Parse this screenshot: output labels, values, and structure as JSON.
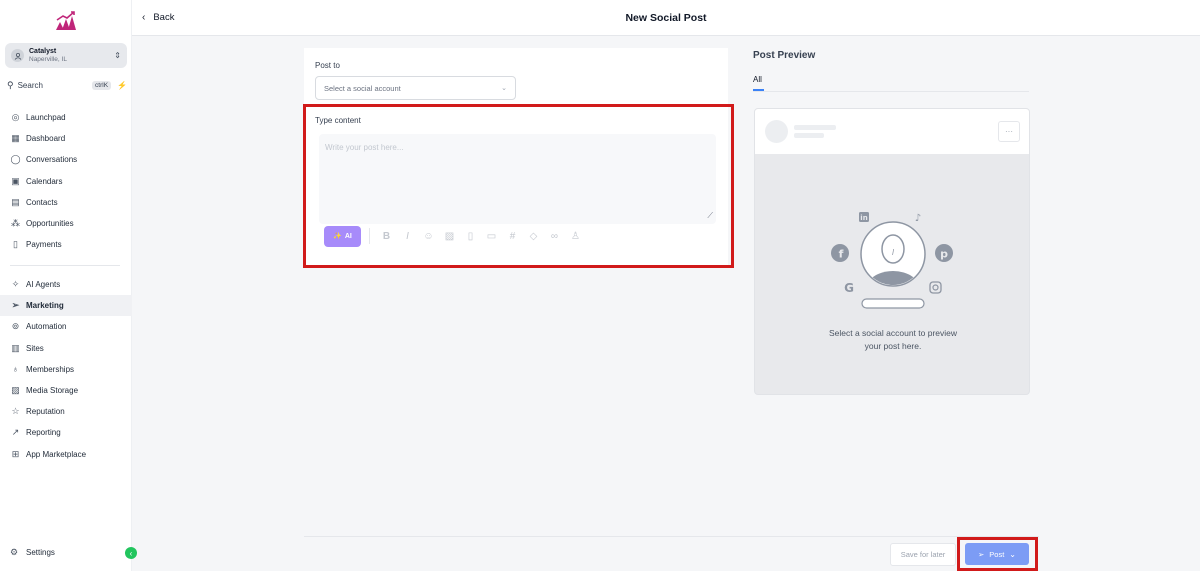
{
  "sidebar": {
    "account": {
      "name": "Catalyst",
      "location": "Naperville, IL"
    },
    "search": {
      "label": "Search",
      "shortcut": "ctrlK"
    },
    "items_top": [
      {
        "label": "Launchpad",
        "icon": "rocket-icon"
      },
      {
        "label": "Dashboard",
        "icon": "grid-icon"
      },
      {
        "label": "Conversations",
        "icon": "chat-icon"
      },
      {
        "label": "Calendars",
        "icon": "calendar-icon"
      },
      {
        "label": "Contacts",
        "icon": "contacts-icon"
      },
      {
        "label": "Opportunities",
        "icon": "pipeline-icon"
      },
      {
        "label": "Payments",
        "icon": "payments-icon"
      }
    ],
    "items_bottom": [
      {
        "label": "AI Agents",
        "icon": "sparkle-icon"
      },
      {
        "label": "Marketing",
        "icon": "send-icon",
        "active": true
      },
      {
        "label": "Automation",
        "icon": "automation-icon"
      },
      {
        "label": "Sites",
        "icon": "sites-icon"
      },
      {
        "label": "Memberships",
        "icon": "award-icon"
      },
      {
        "label": "Media Storage",
        "icon": "image-icon"
      },
      {
        "label": "Reputation",
        "icon": "star-icon"
      },
      {
        "label": "Reporting",
        "icon": "trend-icon"
      },
      {
        "label": "App Marketplace",
        "icon": "apps-icon"
      }
    ],
    "settings_label": "Settings"
  },
  "header": {
    "back_label": "Back",
    "title": "New Social Post"
  },
  "editor": {
    "post_to_label": "Post to",
    "account_select_placeholder": "Select a social account",
    "content_label": "Type content",
    "content_placeholder": "Write your post here...",
    "ai_label": "AI"
  },
  "actions": {
    "save_later_label": "Save for later",
    "post_label": "Post"
  },
  "preview": {
    "title": "Post Preview",
    "tab_all": "All",
    "message_line1": "Select a social account to preview",
    "message_line2": "your post here."
  },
  "colors": {
    "accent": "#7c9cf5",
    "ai": "#a78bfa",
    "highlight": "#d11a1a",
    "online": "#22c55e"
  }
}
